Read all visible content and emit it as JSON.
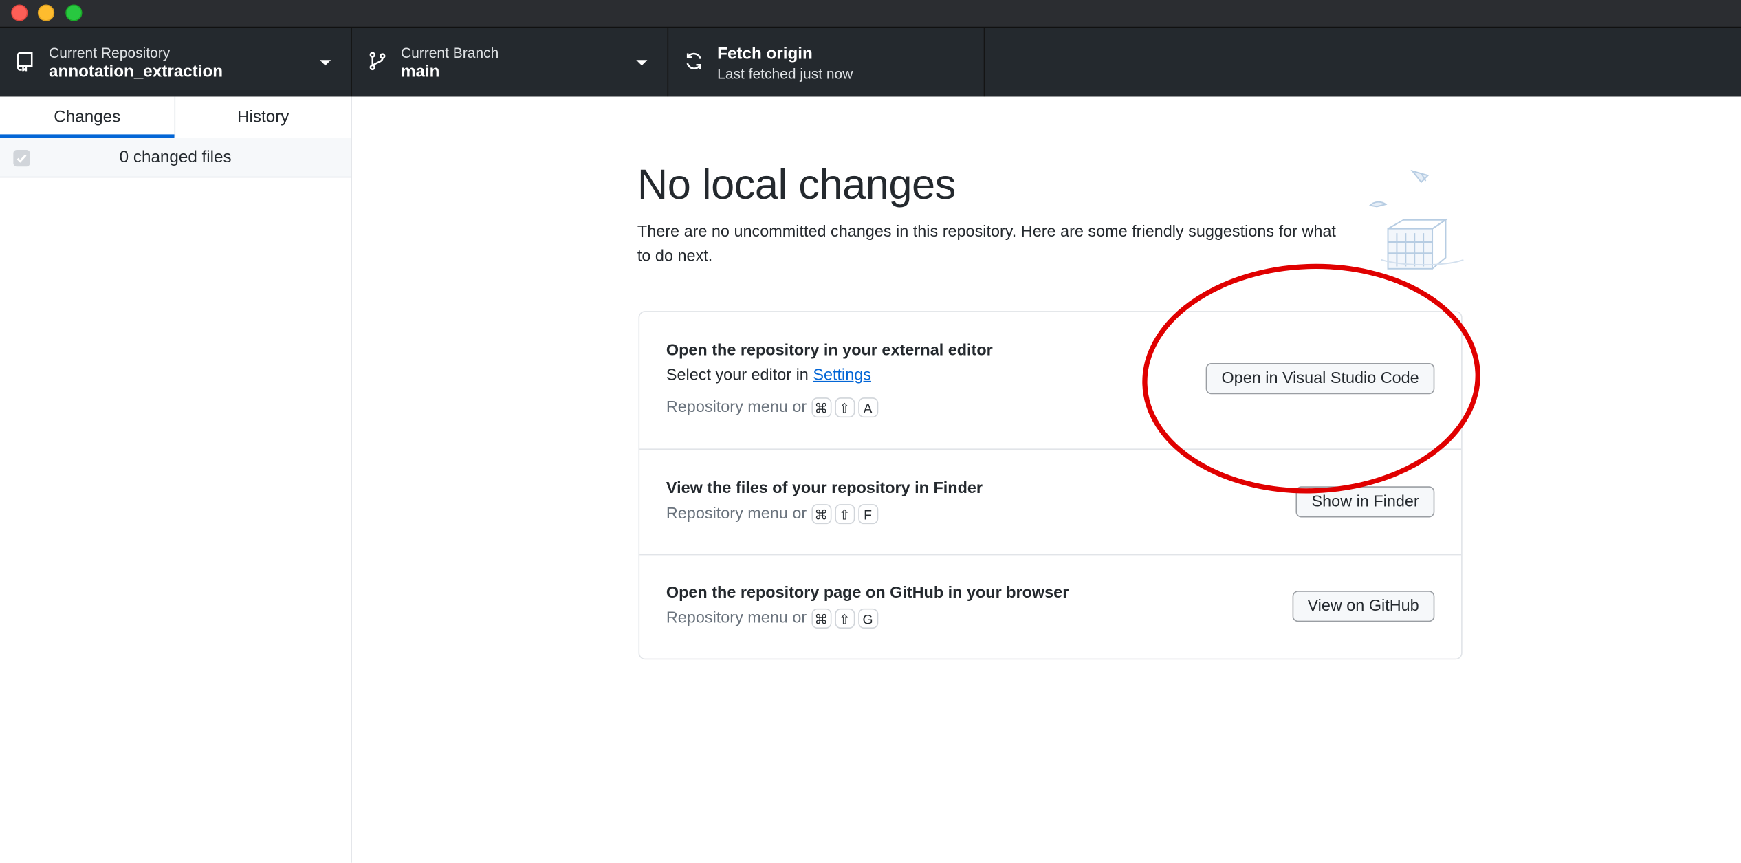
{
  "window": {
    "traffic_lights": [
      {
        "name": "close",
        "color": "#fe5f57"
      },
      {
        "name": "minimize",
        "color": "#febc2e"
      },
      {
        "name": "zoom",
        "color": "#28c840"
      }
    ]
  },
  "toolbar": {
    "repository": {
      "label": "Current Repository",
      "value": "annotation_extraction",
      "icon": "repo-icon"
    },
    "branch": {
      "label": "Current Branch",
      "value": "main",
      "icon": "git-branch-icon"
    },
    "fetch": {
      "title": "Fetch origin",
      "subtitle": "Last fetched just now",
      "icon": "sync-icon"
    }
  },
  "sidebar": {
    "tabs": [
      {
        "label": "Changes",
        "selected": true
      },
      {
        "label": "History",
        "selected": false
      }
    ],
    "changed_files_label": "0 changed files"
  },
  "main": {
    "heading": "No local changes",
    "description": "There are no uncommitted changes in this repository. Here are some friendly suggestions for what to do next.",
    "suggestions": [
      {
        "title": "Open the repository in your external editor",
        "subtitle_prefix": "Select your editor in ",
        "subtitle_link": "Settings",
        "shortcut_prefix": "Repository menu or",
        "keys": [
          "⌘",
          "⇧",
          "A"
        ],
        "button": "Open in Visual Studio Code"
      },
      {
        "title": "View the files of your repository in Finder",
        "shortcut_prefix": "Repository menu or",
        "keys": [
          "⌘",
          "⇧",
          "F"
        ],
        "button": "Show in Finder"
      },
      {
        "title": "Open the repository page on GitHub in your browser",
        "shortcut_prefix": "Repository menu or",
        "keys": [
          "⌘",
          "⇧",
          "G"
        ],
        "button": "View on GitHub"
      }
    ]
  },
  "colors": {
    "toolbar_bg": "#24292e",
    "accent": "#0366d6",
    "annotation_circle": "#e00000"
  }
}
